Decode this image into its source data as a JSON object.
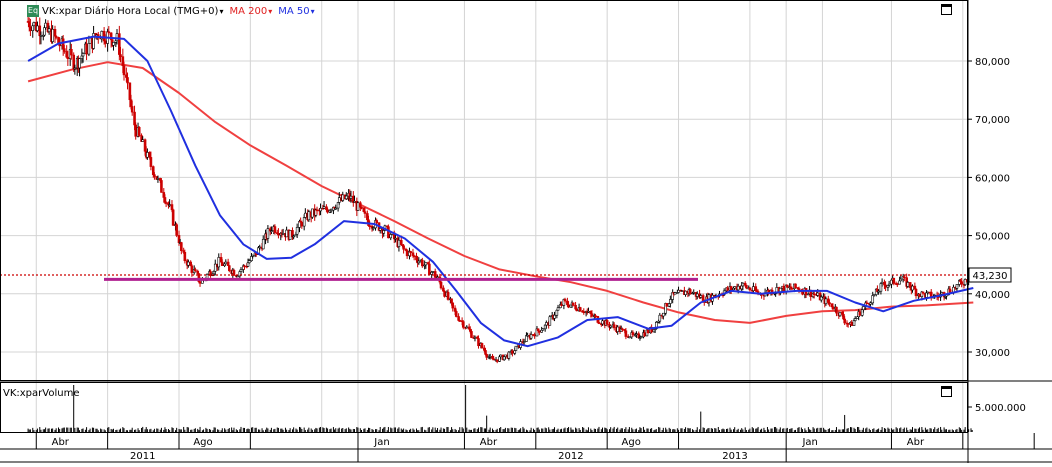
{
  "header": {
    "symbol_badge": "Eq",
    "symbol": "VK:xpar Diário Hora Local (TMG+0)",
    "ma200": "MA 200",
    "ma50": "MA 50",
    "dropdown_glyph": "▾"
  },
  "price_labels": [
    "80,000",
    "70,000",
    "60,000",
    "50,000",
    "40,000",
    "30,000"
  ],
  "last_price": "43,230",
  "volume_panel": {
    "title": "VK:xparVolume",
    "scale_label": "5.000.000"
  },
  "time_months": [
    "Abr",
    "Ago",
    "Jan",
    "Abr",
    "Ago",
    "Jan",
    "Abr"
  ],
  "time_years": [
    "2011",
    "2012",
    "2013"
  ],
  "colors": {
    "up_candle": "#000000",
    "down_candle": "#cc0000",
    "ma200": "#f04040",
    "ma50": "#2030e0",
    "level_line": "#b02090",
    "last_price_line": "#cc0000",
    "grid": "#d4d4d4"
  },
  "chart_data": {
    "type": "line",
    "title": "VK:xpar Diário Hora Local (TMG+0)",
    "ylim": [
      24000,
      90000
    ],
    "price_scale_step": 10000,
    "last_price": 43230,
    "horizontal_level": 43000,
    "x_axis": "monthly dates, daily candlesticks, Abr 2011 – 2013",
    "grid": true,
    "series": [
      {
        "name": "VK:xpar",
        "style": "candlestick",
        "points": [
          [
            "2011-03-25",
            86800
          ],
          [
            "2011-04-15",
            84500
          ],
          [
            "2011-05-05",
            79500
          ],
          [
            "2011-05-25",
            85000
          ],
          [
            "2011-06-10",
            83500
          ],
          [
            "2011-06-25",
            68500
          ],
          [
            "2011-07-10",
            61500
          ],
          [
            "2011-07-25",
            54500
          ],
          [
            "2011-08-05",
            46500
          ],
          [
            "2011-08-20",
            42000
          ],
          [
            "2011-09-05",
            45500
          ],
          [
            "2011-09-20",
            43500
          ],
          [
            "2011-10-05",
            46500
          ],
          [
            "2011-10-20",
            51500
          ],
          [
            "2011-11-05",
            50000
          ],
          [
            "2011-11-20",
            53500
          ],
          [
            "2011-12-05",
            54500
          ],
          [
            "2011-12-25",
            56800
          ],
          [
            "2012-01-10",
            52500
          ],
          [
            "2012-01-25",
            51000
          ],
          [
            "2012-02-10",
            47500
          ],
          [
            "2012-02-25",
            45500
          ],
          [
            "2012-03-10",
            42500
          ],
          [
            "2012-03-25",
            36500
          ],
          [
            "2012-04-10",
            32500
          ],
          [
            "2012-04-25",
            28500
          ],
          [
            "2012-05-10",
            29500
          ],
          [
            "2012-05-25",
            32500
          ],
          [
            "2012-06-10",
            34500
          ],
          [
            "2012-06-25",
            38500
          ],
          [
            "2012-07-10",
            37500
          ],
          [
            "2012-07-25",
            35500
          ],
          [
            "2012-08-10",
            34000
          ],
          [
            "2012-08-25",
            32500
          ],
          [
            "2012-09-10",
            34000
          ],
          [
            "2012-09-25",
            39500
          ],
          [
            "2012-10-10",
            40500
          ],
          [
            "2012-10-25",
            39000
          ],
          [
            "2012-11-10",
            40500
          ],
          [
            "2012-11-25",
            41500
          ],
          [
            "2012-12-10",
            40000
          ],
          [
            "2012-12-25",
            40800
          ],
          [
            "2013-01-10",
            41000
          ],
          [
            "2013-01-25",
            40000
          ],
          [
            "2013-02-10",
            38000
          ],
          [
            "2013-02-25",
            34500
          ],
          [
            "2013-03-10",
            38000
          ],
          [
            "2013-03-25",
            41500
          ],
          [
            "2013-04-10",
            42500
          ],
          [
            "2013-04-25",
            40000
          ],
          [
            "2013-05-10",
            39500
          ],
          [
            "2013-05-25",
            41000
          ],
          [
            "2013-06-10",
            43230
          ]
        ]
      },
      {
        "name": "MA 200",
        "style": "line",
        "points": [
          [
            "2011-03-25",
            76500
          ],
          [
            "2011-05-01",
            78500
          ],
          [
            "2011-06-01",
            79800
          ],
          [
            "2011-07-01",
            78800
          ],
          [
            "2011-08-01",
            74500
          ],
          [
            "2011-09-01",
            69500
          ],
          [
            "2011-10-01",
            65500
          ],
          [
            "2011-11-01",
            62000
          ],
          [
            "2011-12-01",
            58500
          ],
          [
            "2012-01-01",
            55500
          ],
          [
            "2012-02-01",
            52500
          ],
          [
            "2012-03-01",
            49500
          ],
          [
            "2012-04-01",
            46500
          ],
          [
            "2012-05-01",
            44200
          ],
          [
            "2012-06-01",
            43000
          ],
          [
            "2012-07-01",
            42000
          ],
          [
            "2012-08-01",
            40500
          ],
          [
            "2012-09-01",
            38500
          ],
          [
            "2012-10-01",
            36800
          ],
          [
            "2012-11-01",
            35500
          ],
          [
            "2012-12-01",
            35000
          ],
          [
            "2013-01-01",
            36200
          ],
          [
            "2013-02-01",
            37000
          ],
          [
            "2013-03-01",
            37200
          ],
          [
            "2013-04-01",
            37800
          ],
          [
            "2013-05-01",
            38000
          ],
          [
            "2013-06-10",
            38500
          ]
        ]
      },
      {
        "name": "MA 50",
        "style": "line",
        "points": [
          [
            "2011-03-25",
            80000
          ],
          [
            "2011-04-20",
            83000
          ],
          [
            "2011-05-20",
            84200
          ],
          [
            "2011-06-15",
            83800
          ],
          [
            "2011-07-05",
            80000
          ],
          [
            "2011-07-25",
            71500
          ],
          [
            "2011-08-15",
            62000
          ],
          [
            "2011-09-05",
            53500
          ],
          [
            "2011-09-25",
            48500
          ],
          [
            "2011-10-15",
            46000
          ],
          [
            "2011-11-05",
            46200
          ],
          [
            "2011-11-25",
            48500
          ],
          [
            "2011-12-20",
            52500
          ],
          [
            "2012-01-15",
            52000
          ],
          [
            "2012-02-10",
            49500
          ],
          [
            "2012-03-05",
            45500
          ],
          [
            "2012-03-25",
            40500
          ],
          [
            "2012-04-15",
            35000
          ],
          [
            "2012-05-05",
            32000
          ],
          [
            "2012-05-25",
            31000
          ],
          [
            "2012-06-20",
            32500
          ],
          [
            "2012-07-15",
            35500
          ],
          [
            "2012-08-10",
            36000
          ],
          [
            "2012-09-05",
            34000
          ],
          [
            "2012-09-25",
            34500
          ],
          [
            "2012-10-20",
            38500
          ],
          [
            "2012-11-15",
            40500
          ],
          [
            "2012-12-10",
            40000
          ],
          [
            "2013-01-10",
            40500
          ],
          [
            "2013-02-05",
            40500
          ],
          [
            "2013-03-01",
            38500
          ],
          [
            "2013-03-25",
            37000
          ],
          [
            "2013-04-20",
            38800
          ],
          [
            "2013-05-15",
            39800
          ],
          [
            "2013-06-10",
            41000
          ]
        ]
      }
    ],
    "volume": {
      "name": "VK:xparVolume",
      "style": "bars",
      "ylim": [
        0,
        10000000
      ],
      "scale_label_value": 5000000,
      "spikes": [
        [
          "2011-05-03",
          7500000
        ],
        [
          "2011-08-10",
          2500000
        ],
        [
          "2011-12-20",
          2000000
        ],
        [
          "2012-04-02",
          8200000
        ],
        [
          "2012-04-20",
          2400000
        ],
        [
          "2012-10-20",
          3000000
        ],
        [
          "2013-02-20",
          2500000
        ]
      ]
    }
  }
}
